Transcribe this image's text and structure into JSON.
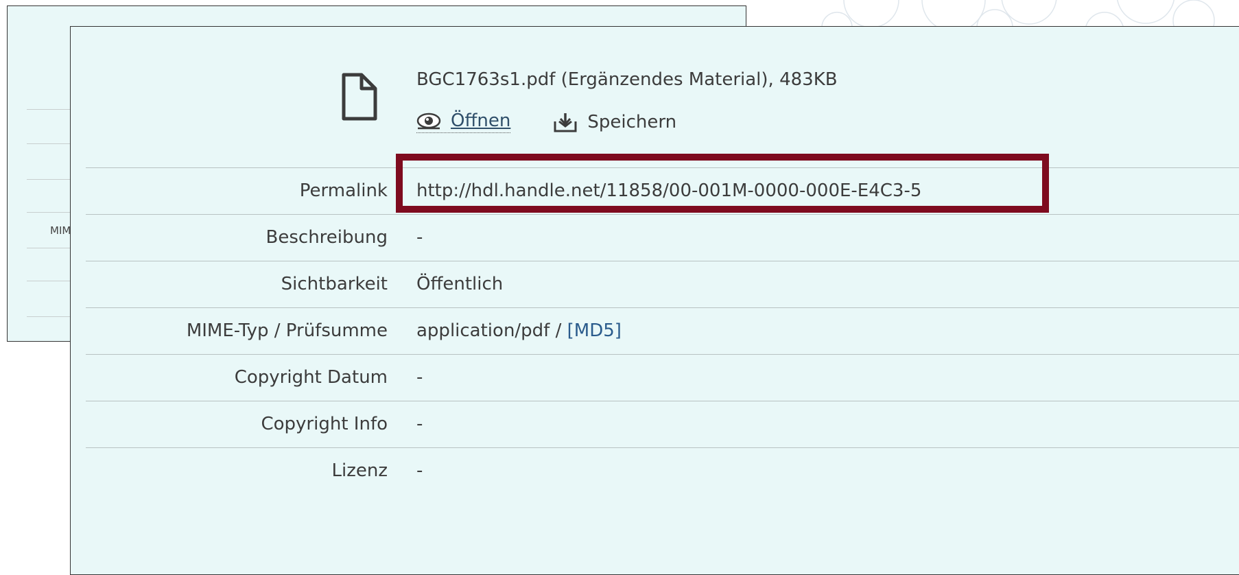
{
  "file": {
    "title": "BGC1763s1.pdf (Ergänzendes Material), 483KB",
    "open_label": "Öffnen",
    "save_label": "Speichern",
    "icon": "file-icon"
  },
  "back_panel": {
    "mime_fragment": "MIM"
  },
  "rows": [
    {
      "label": "Permalink",
      "value": "http://hdl.handle.net/11858/00-001M-0000-000E-E4C3-5"
    },
    {
      "label": "Beschreibung",
      "value": "-"
    },
    {
      "label": "Sichtbarkeit",
      "value": "Öffentlich"
    },
    {
      "label": "MIME-Typ / Prüfsumme",
      "value": "application/pdf / ",
      "link": "[MD5]"
    },
    {
      "label": "Copyright Datum",
      "value": "-"
    },
    {
      "label": "Copyright Info",
      "value": "-"
    },
    {
      "label": "Lizenz",
      "value": "-"
    }
  ],
  "colors": {
    "panel_bg": "#e9f8f8",
    "highlight": "#7e0b1f",
    "link": "#2a5b8c"
  }
}
